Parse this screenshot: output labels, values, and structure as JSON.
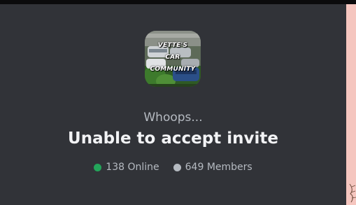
{
  "guild": {
    "icon_lines": [
      "VETTE'S",
      "CAR",
      "COMMUNITY"
    ]
  },
  "invite": {
    "subtitle": "Whoops...",
    "title": "Unable to accept invite"
  },
  "stats": {
    "online_label": "138 Online",
    "members_label": "649 Members",
    "online_color": "#23a55a",
    "members_color": "#b5bac1"
  }
}
